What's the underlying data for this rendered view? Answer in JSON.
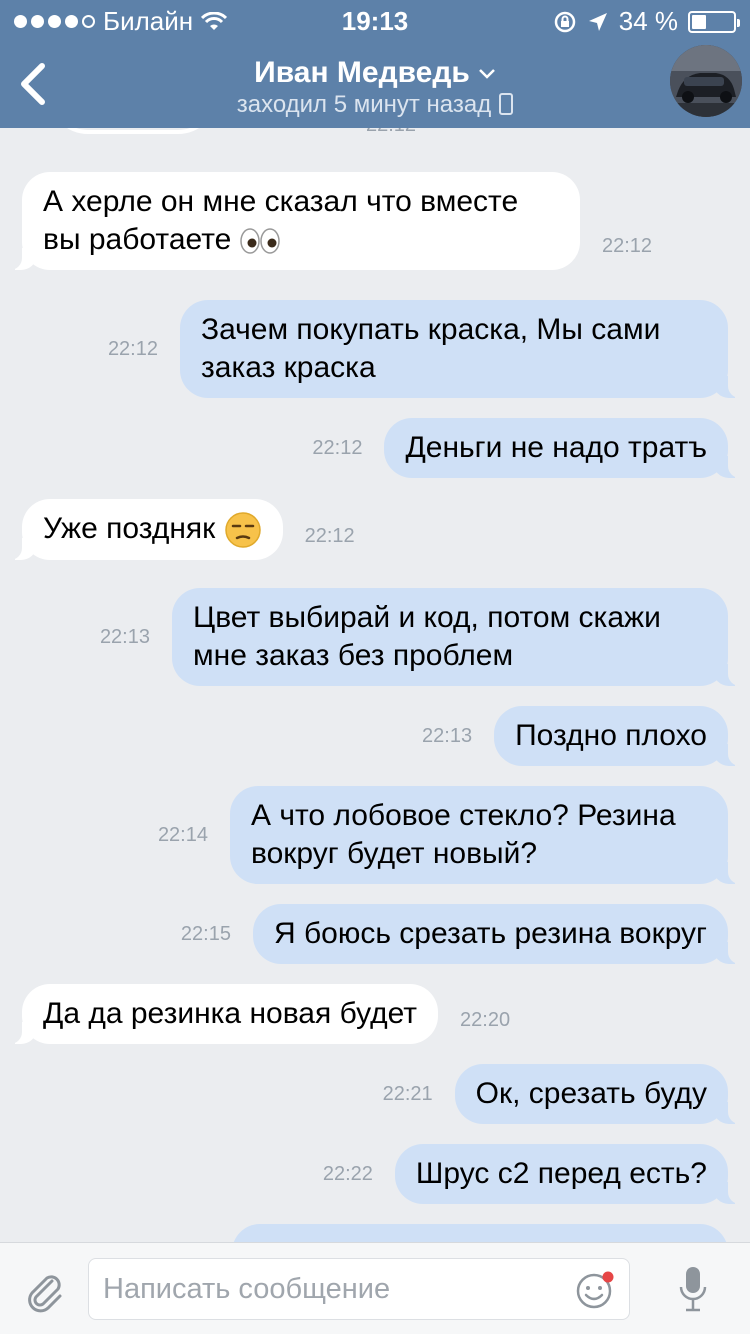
{
  "status_bar": {
    "carrier": "Билайн",
    "time": "19:13",
    "battery_percent_text": "34 %",
    "battery_level": 0.34
  },
  "header": {
    "contact_name": "Иван Медведь",
    "last_seen": "заходил 5 минут назад",
    "top_partial_time": "22:12"
  },
  "messages": [
    {
      "dir": "in",
      "text": "А херле он мне сказал что вместе вы работаете",
      "emoji": "eyes-emoji",
      "time": "22:12"
    },
    {
      "dir": "out",
      "text": "Зачем покупать краска, Мы сами заказ краска",
      "time": "22:12"
    },
    {
      "dir": "out",
      "text": "Деньги не надо тратъ",
      "time": "22:12"
    },
    {
      "dir": "in",
      "text": "Уже поздняк",
      "emoji": "unamused-face-emoji",
      "time": "22:12"
    },
    {
      "dir": "out",
      "text": "Цвет выбирай и код, потом скажи мне заказ без проблем",
      "time": "22:13"
    },
    {
      "dir": "out",
      "text": "Поздно плохо",
      "time": "22:13"
    },
    {
      "dir": "out",
      "text": "А что лобовое стекло? Резина вокруг будет новый?",
      "time": "22:14"
    },
    {
      "dir": "out",
      "text": "Я боюсь срезать резина вокруг",
      "time": "22:15"
    },
    {
      "dir": "in",
      "text": "Да да резинка новая будет",
      "time": "22:20"
    },
    {
      "dir": "out",
      "text": "Ок, срезать буду",
      "time": "22:21"
    },
    {
      "dir": "out",
      "text": "Шрус с2 перед есть?",
      "time": "22:22"
    }
  ],
  "composer": {
    "placeholder": "Написать сообщение"
  },
  "colors": {
    "header_bg": "#5d81a9",
    "chat_bg": "#ebedf0",
    "incoming_bubble": "#ffffff",
    "outgoing_bubble": "#cfe0f6"
  },
  "icons": [
    "back-chevron-icon",
    "wifi-icon",
    "lock-rotation-icon",
    "location-arrow-icon",
    "battery-icon",
    "phone-icon",
    "paperclip-icon",
    "smile-icon",
    "microphone-icon"
  ]
}
